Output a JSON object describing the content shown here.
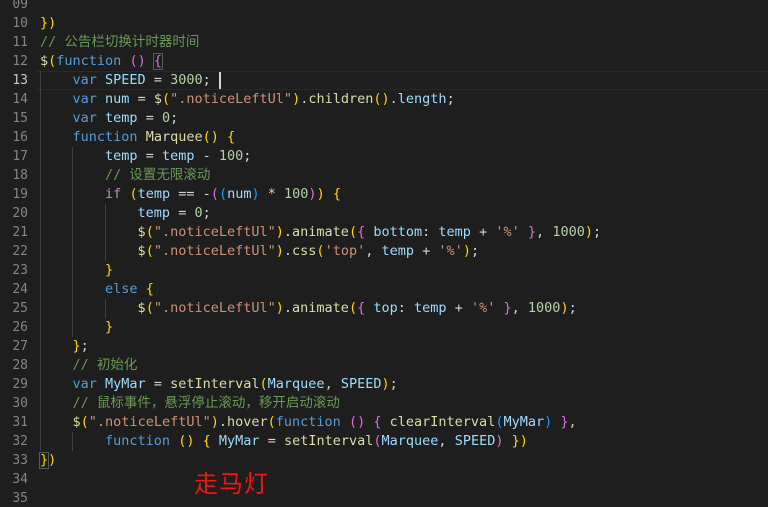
{
  "editor": {
    "language": "javascript",
    "theme": "Dark+ (default dark)",
    "background_color": "#1e1e1e",
    "gutter_color": "#858585",
    "active_line": 13,
    "cursor_line": 13,
    "cursor_column": 22,
    "first_visible_line": 9,
    "last_visible_line": 35
  },
  "line_numbers": [
    "09",
    "10",
    "11",
    "12",
    "13",
    "14",
    "15",
    "16",
    "17",
    "18",
    "19",
    "20",
    "21",
    "22",
    "23",
    "24",
    "25",
    "26",
    "27",
    "28",
    "29",
    "30",
    "31",
    "32",
    "33",
    "34",
    "35"
  ],
  "lines": [
    {
      "num": "09",
      "text": ""
    },
    {
      "num": "10",
      "text": "})"
    },
    {
      "num": "11",
      "text": "// 公告栏切换计时器时间"
    },
    {
      "num": "12",
      "text": "$(function () {"
    },
    {
      "num": "13",
      "text": "    var SPEED = 3000;"
    },
    {
      "num": "14",
      "text": "    var num = $(\".noticeLeftUl\").children().length;"
    },
    {
      "num": "15",
      "text": "    var temp = 0;"
    },
    {
      "num": "16",
      "text": "    function Marquee() {"
    },
    {
      "num": "17",
      "text": "        temp = temp - 100;"
    },
    {
      "num": "18",
      "text": "        // 设置无限滚动"
    },
    {
      "num": "19",
      "text": "        if (temp == -((num) * 100)) {"
    },
    {
      "num": "20",
      "text": "            temp = 0;"
    },
    {
      "num": "21",
      "text": "            $(\".noticeLeftUl\").animate({ bottom: temp + '%' }, 1000);"
    },
    {
      "num": "22",
      "text": "            $(\".noticeLeftUl\").css('top', temp + '%');"
    },
    {
      "num": "23",
      "text": "        }"
    },
    {
      "num": "24",
      "text": "        else {"
    },
    {
      "num": "25",
      "text": "            $(\".noticeLeftUl\").animate({ top: temp + '%' }, 1000);"
    },
    {
      "num": "26",
      "text": "        }"
    },
    {
      "num": "27",
      "text": "    };"
    },
    {
      "num": "28",
      "text": "    // 初始化"
    },
    {
      "num": "29",
      "text": "    var MyMar = setInterval(Marquee, SPEED);"
    },
    {
      "num": "30",
      "text": "    // 鼠标事件，悬浮停止滚动，移开启动滚动"
    },
    {
      "num": "31",
      "text": "    $(\".noticeLeftUl\").hover(function () { clearInterval(MyMar) },"
    },
    {
      "num": "32",
      "text": "        function () { MyMar = setInterval(Marquee, SPEED) })"
    },
    {
      "num": "33",
      "text": "})"
    },
    {
      "num": "34",
      "text": ""
    },
    {
      "num": "35",
      "text": ""
    }
  ],
  "annotation": {
    "text": "走马灯",
    "color": "#f01414"
  },
  "syntax_colors": {
    "keyword": "#569cd6",
    "control": "#c586c0",
    "variable": "#9cdcfe",
    "function": "#dcdcaa",
    "string": "#ce9178",
    "number": "#b5cea8",
    "comment": "#6a9955",
    "operator": "#d4d4d4",
    "bracket_level_1": "#ffd700",
    "bracket_level_2": "#da70d6",
    "bracket_level_3": "#179fff"
  }
}
